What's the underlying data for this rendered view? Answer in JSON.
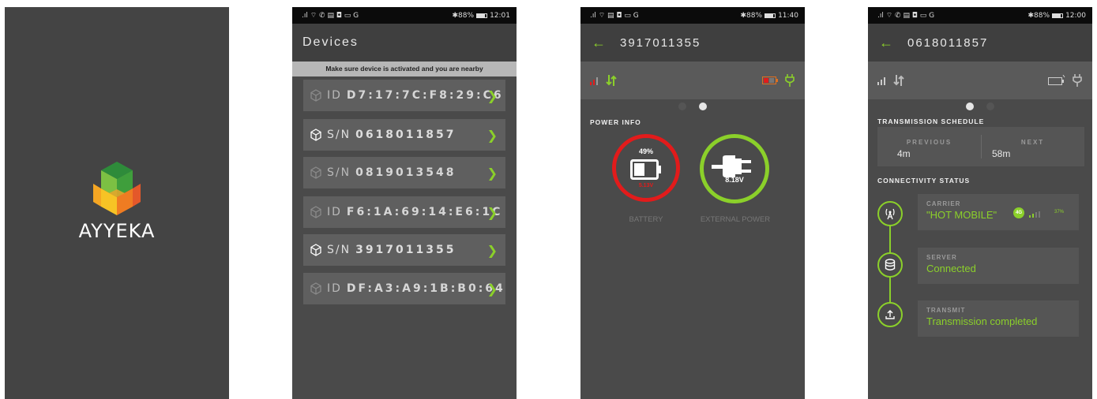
{
  "brand": {
    "name": "AYYEKA"
  },
  "colors": {
    "accent": "#8bd02a",
    "alert": "#e21b1b",
    "background": "#4a4a4a"
  },
  "screens": [
    {
      "id": "splash"
    },
    {
      "id": "devices",
      "status": {
        "left": ".ıl ⌔ ✆ ▤ ◘ ▭ G",
        "battery": "✱88%",
        "time": "12:01"
      },
      "title": "Devices",
      "notice": "Make sure device is activated and you are nearby",
      "items": [
        {
          "prefix": "ID",
          "value": "D7:17:7C:F8:29:C6",
          "icon": "cube-icon",
          "dim": true
        },
        {
          "prefix": "S/N",
          "value": "0618011857",
          "icon": "cube-icon",
          "dim": false
        },
        {
          "prefix": "S/N",
          "value": "0819013548",
          "icon": "cube-icon",
          "dim": true
        },
        {
          "prefix": "ID",
          "value": "F6:1A:69:14:E6:1C",
          "icon": "cube-icon",
          "dim": true
        },
        {
          "prefix": "S/N",
          "value": "3917011355",
          "icon": "cube-icon",
          "dim": false
        },
        {
          "prefix": "ID",
          "value": "DF:A3:A9:1B:B0:64",
          "icon": "cube-icon",
          "dim": true
        }
      ]
    },
    {
      "id": "power",
      "status": {
        "left": ".ıl ⌔ ▤ ◘ ▭ G",
        "battery": "✱88%",
        "time": "11:40"
      },
      "serial": "3917011355",
      "section": "POWER INFO",
      "battery": {
        "percent": "49%",
        "voltage": "5.13V",
        "caption": "BATTERY",
        "level": 0.49
      },
      "external": {
        "voltage": "8.18V",
        "caption": "EXTERNAL POWER"
      },
      "page_dots": {
        "active": 1,
        "count": 2
      }
    },
    {
      "id": "connectivity",
      "status": {
        "left": ".ıl ⌔ ✆ ▤ ◘ ▭ G",
        "battery": "✱88%",
        "time": "12:00"
      },
      "serial": "0618011857",
      "schedule_title": "TRANSMISSION SCHEDULE",
      "previous": {
        "label": "PREVIOUS",
        "value": "4m"
      },
      "next": {
        "label": "NEXT",
        "value": "58m"
      },
      "connectivity_title": "CONNECTIVITY STATUS",
      "carrier": {
        "label": "CARRIER",
        "value": "\"HOT MOBILE\"",
        "network": "4G",
        "signal": "37%"
      },
      "server": {
        "label": "SERVER",
        "value": "Connected"
      },
      "transmit": {
        "label": "TRANSMIT",
        "value": "Transmission completed"
      },
      "page_dots": {
        "active": 0,
        "count": 2
      }
    }
  ]
}
